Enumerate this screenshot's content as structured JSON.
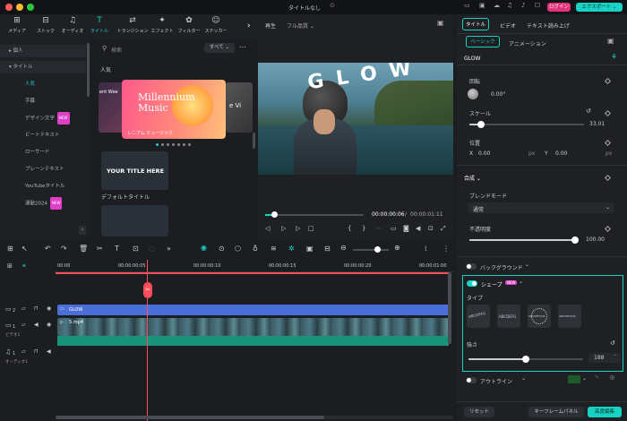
{
  "window": {
    "title": "タイトルなし",
    "login": "ログイン",
    "export": "エクスポート"
  },
  "toolbar": {
    "items": [
      {
        "label": "メディア",
        "icon": "media-icon"
      },
      {
        "label": "ストック",
        "icon": "stock-icon"
      },
      {
        "label": "オーディオ",
        "icon": "audio-icon"
      },
      {
        "label": "タイトル",
        "icon": "title-icon"
      },
      {
        "label": "トランジション",
        "icon": "transition-icon"
      },
      {
        "label": "エフェクト",
        "icon": "effect-icon"
      },
      {
        "label": "フィルター",
        "icon": "filter-icon"
      },
      {
        "label": "ステッカー",
        "icon": "sticker-icon"
      }
    ]
  },
  "sidebar": {
    "items": [
      {
        "label": "個人"
      },
      {
        "label": "タイトル"
      },
      {
        "label": "人気"
      },
      {
        "label": "字幕"
      },
      {
        "label": "デザイン文字",
        "badge": "NEW"
      },
      {
        "label": "ビートテキスト"
      },
      {
        "label": "ローサード"
      },
      {
        "label": "プレーンテキスト"
      },
      {
        "label": "YouTubeタイトル"
      },
      {
        "label": "運動2024",
        "badge": "NEW"
      }
    ]
  },
  "library": {
    "search_placeholder": "検索",
    "filter": "すべて",
    "section": "人気",
    "featured_title": "Millennium Music",
    "featured_caption": "レニアム ミュージック",
    "side_left_caption": "ent Wee",
    "side_right_caption": "e Vi",
    "item_title": "YOUR TITLE HERE",
    "item_caption": "デフォルトタイトル"
  },
  "preview": {
    "label": "再生",
    "quality": "フル品質",
    "overlay_text": "GLOW",
    "current_time": "00:00:00:06",
    "total_time": "00:00:01:11",
    "progress": 0.09
  },
  "rightpanel": {
    "tabs": [
      "タイトル",
      "ビデオ",
      "テキスト読み上げ"
    ],
    "subtabs": [
      "ベーシック",
      "アニメーション"
    ],
    "clip_name": "GLOW",
    "rotation_label": "回転",
    "rotation_value": "0.00°",
    "scale_label": "スケール",
    "scale_value": "33.01",
    "scale_level": 0.1,
    "position_label": "位置",
    "pos_x_label": "X",
    "pos_x": "0.00",
    "pos_y_label": "Y",
    "pos_y": "0.00",
    "unit": "px",
    "composite_label": "合成",
    "blend_label": "ブレンドモード",
    "blend_value": "通常",
    "opacity_label": "不透明度",
    "opacity_value": "100.00",
    "opacity_level": 1.0,
    "background_label": "バックグラウンド",
    "shape_label": "シェープ",
    "shape_badge": "NEW",
    "type_label": "タイプ",
    "shape_types": [
      "ABCDEFG",
      "ABCDEFG",
      "ABCDEFGHIJ",
      "ABCDEFGHIJ"
    ],
    "strength_label": "強さ",
    "strength_value": "188",
    "strength_level": 0.5,
    "outline_label": "アウトライン",
    "outline_color": "#1e5a2a",
    "reset_label": "リセット",
    "keyframe_label": "キーフレームパネル",
    "advanced_label": "高度編集"
  },
  "timeline": {
    "ruler": [
      "00:00",
      "00:00:00:05",
      "00:00:00:10",
      "00:00:00:15",
      "00:00:00:20",
      "00:00:01:00"
    ],
    "tracks": [
      {
        "num": "2",
        "clip": "GLOW"
      },
      {
        "num": "1",
        "label": "ビデオ1",
        "clip": "5.mp4"
      },
      {
        "num": "1",
        "label": "オーディオ1"
      }
    ]
  },
  "colors": {
    "accent": "#18d2c3",
    "title_clip": "#4a6fd8",
    "audio_clip": "#1a9478",
    "playhead": "#ff4d5a"
  }
}
